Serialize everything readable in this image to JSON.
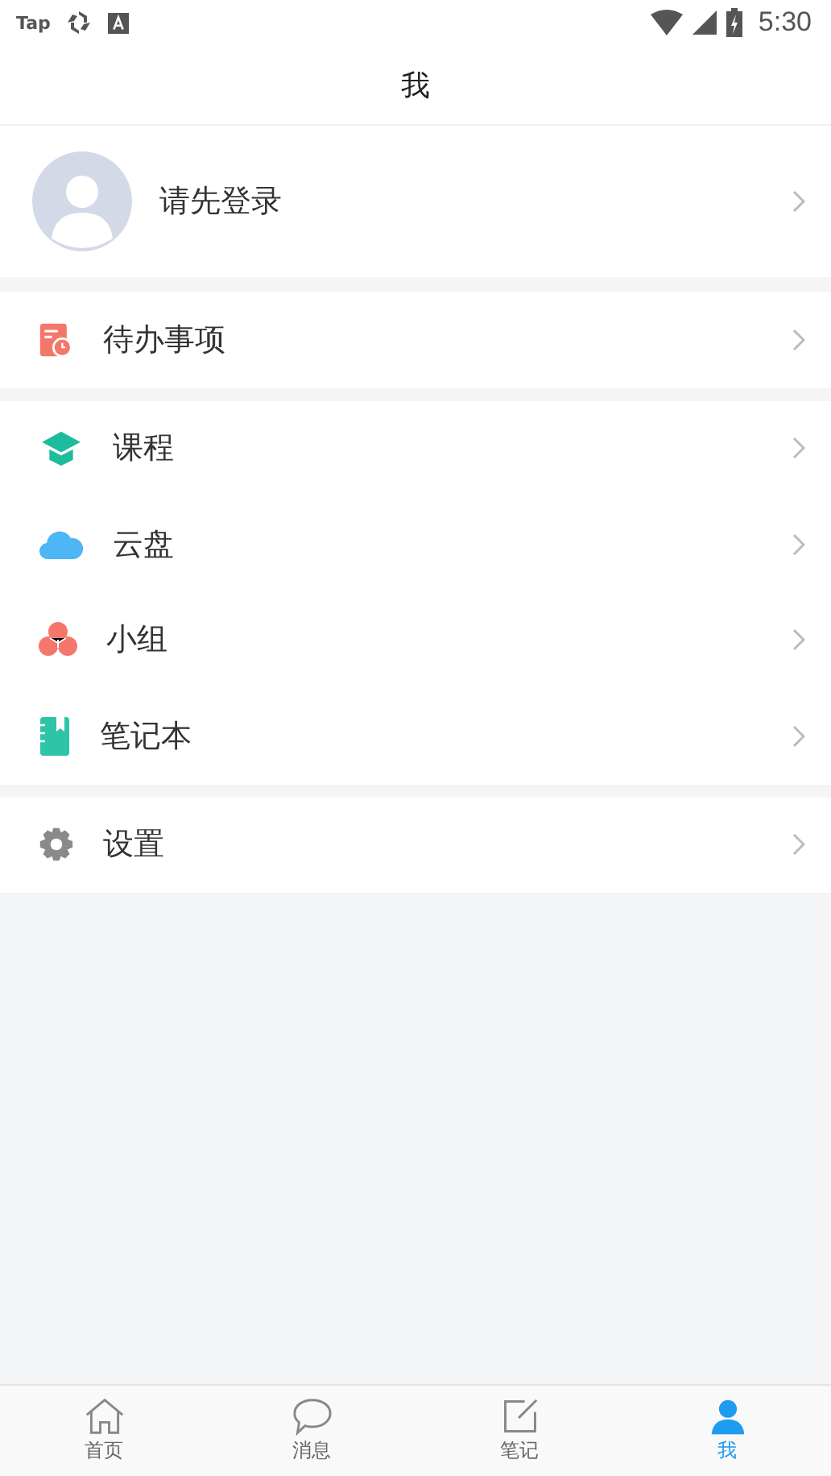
{
  "status_bar": {
    "apps": [
      "Tap"
    ],
    "time": "5:30"
  },
  "header": {
    "title": "我"
  },
  "profile": {
    "name": "请先登录"
  },
  "sections": [
    [
      {
        "kind": "todo",
        "label": "待办事项"
      }
    ],
    [
      {
        "kind": "course",
        "label": "课程"
      },
      {
        "kind": "cloud",
        "label": "云盘"
      },
      {
        "kind": "group",
        "label": "小组"
      },
      {
        "kind": "notebook",
        "label": "笔记本"
      }
    ],
    [
      {
        "kind": "settings",
        "label": "设置"
      }
    ]
  ],
  "tabs": [
    {
      "kind": "home",
      "label": "首页",
      "selected": false
    },
    {
      "kind": "message",
      "label": "消息",
      "selected": false
    },
    {
      "kind": "note",
      "label": "笔记",
      "selected": false
    },
    {
      "kind": "me",
      "label": "我",
      "selected": true
    }
  ]
}
